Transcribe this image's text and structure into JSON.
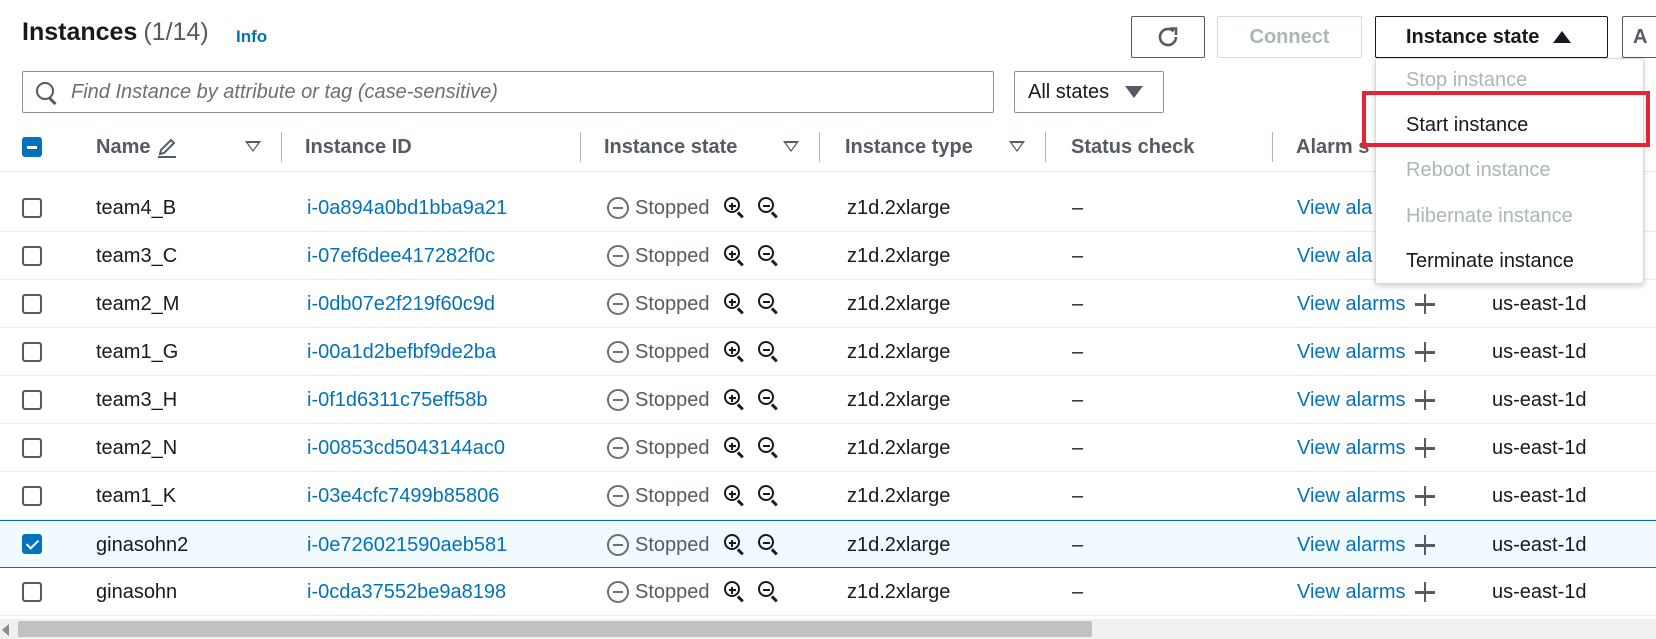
{
  "header": {
    "title": "Instances",
    "count": "(1/14)",
    "info": "Info"
  },
  "toolbar": {
    "refresh_icon": "refresh-icon",
    "connect_label": "Connect",
    "instance_state_label": "Instance state",
    "more_label": "A"
  },
  "search": {
    "placeholder": "Find Instance by attribute or tag (case-sensitive)",
    "value": ""
  },
  "filter": {
    "selected": "All states"
  },
  "columns": [
    {
      "label": "Name",
      "has_edit_icon": true,
      "sortable": true
    },
    {
      "label": "Instance ID",
      "sortable": false
    },
    {
      "label": "Instance state",
      "sortable": true
    },
    {
      "label": "Instance type",
      "sortable": true
    },
    {
      "label": "Status check",
      "sortable": false
    },
    {
      "label": "Alarm s",
      "sortable": false
    }
  ],
  "rows": [
    {
      "name": "team4_B",
      "id": "i-0a894a0bd1bba9a21",
      "state": "Stopped",
      "type": "z1d.2xlarge",
      "status": "–",
      "alarms": "View ala",
      "az": "",
      "selected": false
    },
    {
      "name": "team3_C",
      "id": "i-07ef6dee417282f0c",
      "state": "Stopped",
      "type": "z1d.2xlarge",
      "status": "–",
      "alarms": "View ala",
      "az": "",
      "selected": false
    },
    {
      "name": "team2_M",
      "id": "i-0db07e2f219f60c9d",
      "state": "Stopped",
      "type": "z1d.2xlarge",
      "status": "–",
      "alarms": "View alarms",
      "az": "us-east-1d",
      "selected": false
    },
    {
      "name": "team1_G",
      "id": "i-00a1d2befbf9de2ba",
      "state": "Stopped",
      "type": "z1d.2xlarge",
      "status": "–",
      "alarms": "View alarms",
      "az": "us-east-1d",
      "selected": false
    },
    {
      "name": "team3_H",
      "id": "i-0f1d6311c75eff58b",
      "state": "Stopped",
      "type": "z1d.2xlarge",
      "status": "–",
      "alarms": "View alarms",
      "az": "us-east-1d",
      "selected": false
    },
    {
      "name": "team2_N",
      "id": "i-00853cd5043144ac0",
      "state": "Stopped",
      "type": "z1d.2xlarge",
      "status": "–",
      "alarms": "View alarms",
      "az": "us-east-1d",
      "selected": false
    },
    {
      "name": "team1_K",
      "id": "i-03e4cfc7499b85806",
      "state": "Stopped",
      "type": "z1d.2xlarge",
      "status": "–",
      "alarms": "View alarms",
      "az": "us-east-1d",
      "selected": false
    },
    {
      "name": "ginasohn2",
      "id": "i-0e726021590aeb581",
      "state": "Stopped",
      "type": "z1d.2xlarge",
      "status": "–",
      "alarms": "View alarms",
      "az": "us-east-1d",
      "selected": true
    },
    {
      "name": "ginasohn",
      "id": "i-0cda37552be9a8198",
      "state": "Stopped",
      "type": "z1d.2xlarge",
      "status": "–",
      "alarms": "View alarms",
      "az": "us-east-1d",
      "selected": false
    }
  ],
  "dropdown": {
    "items": [
      {
        "label": "Stop instance",
        "disabled": true
      },
      {
        "label": "Start instance",
        "disabled": false,
        "highlighted": true
      },
      {
        "label": "Reboot instance",
        "disabled": true
      },
      {
        "label": "Hibernate instance",
        "disabled": true
      },
      {
        "label": "Terminate instance",
        "disabled": false
      }
    ]
  },
  "colors": {
    "link": "#0073bb",
    "highlight_box": "#e32633",
    "selected_row_bg": "#f1faff"
  }
}
